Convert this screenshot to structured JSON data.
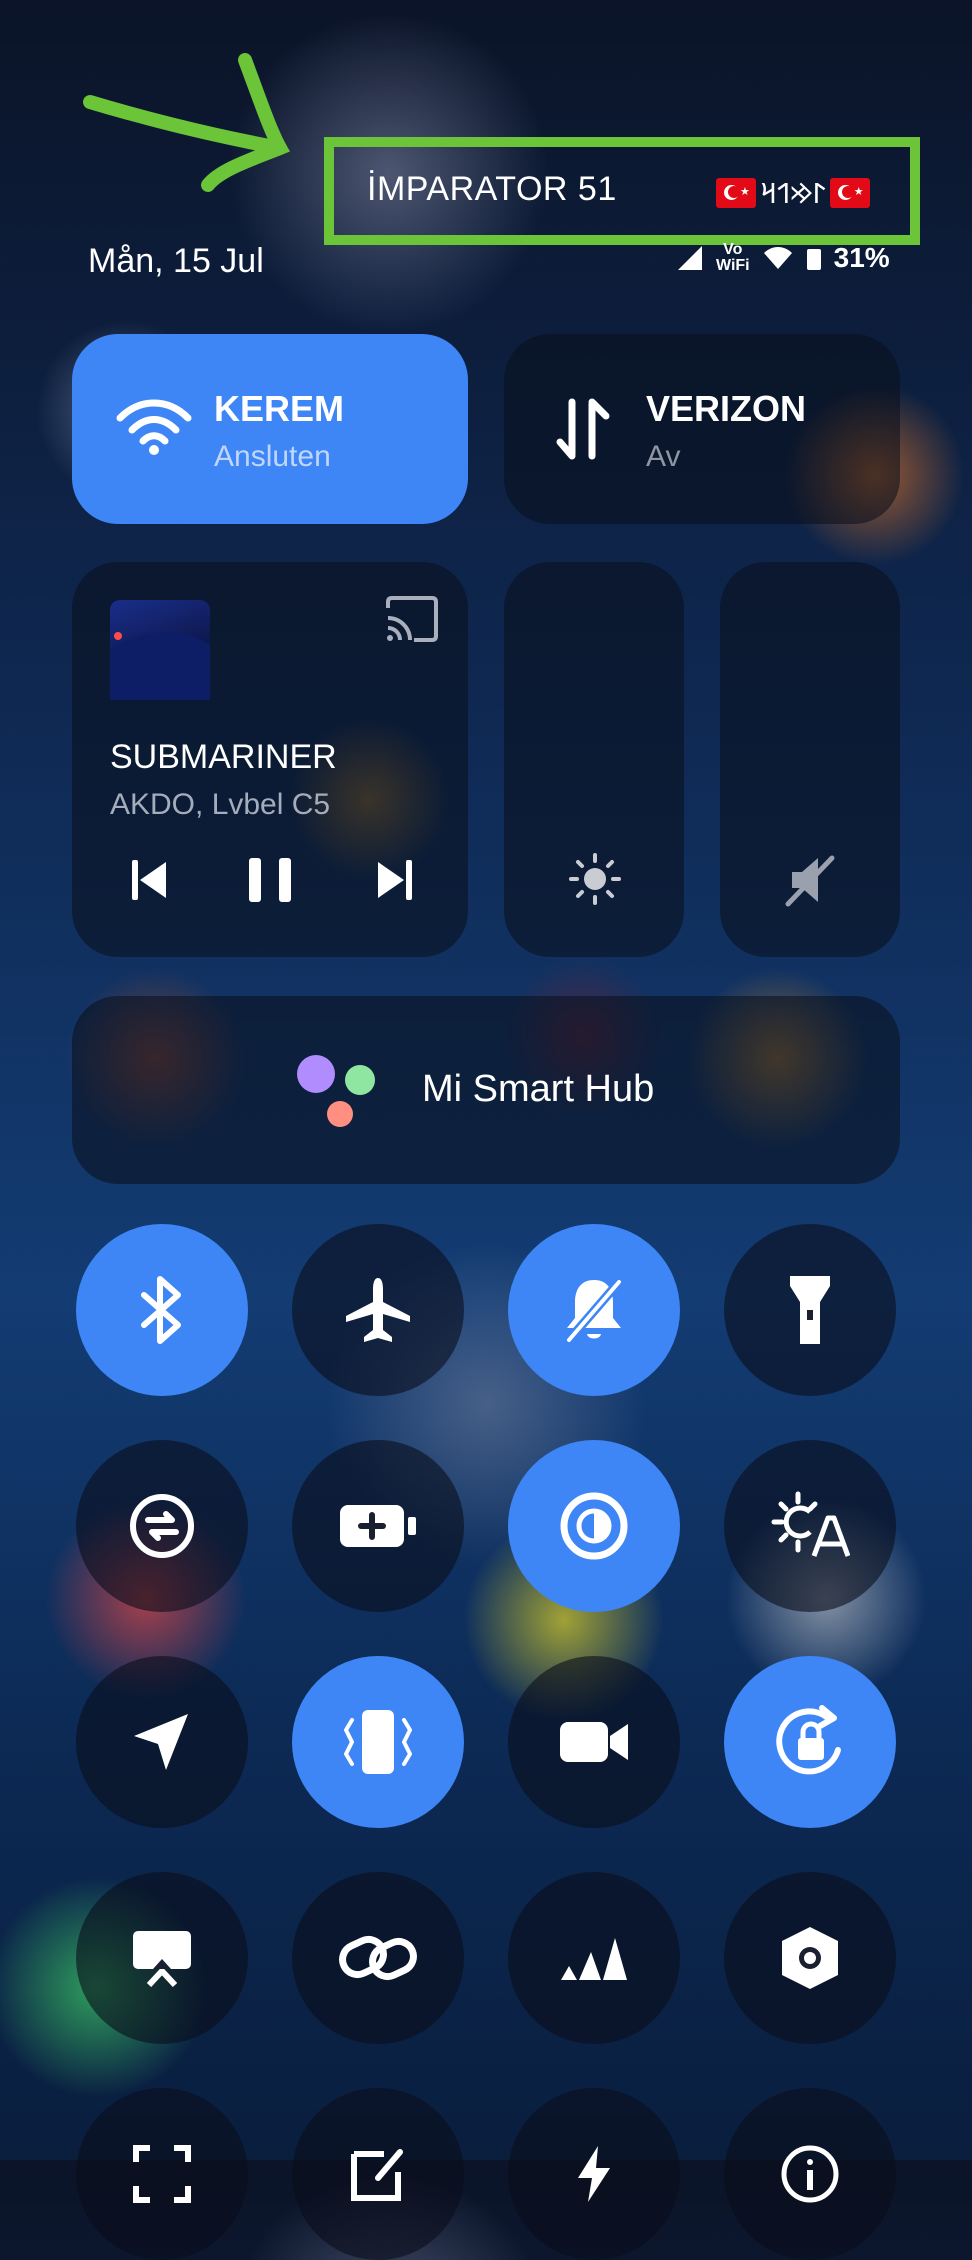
{
  "annotation": {
    "box_color": "#6cc439"
  },
  "header": {
    "carrier_label": "İMPARATOR 51",
    "turkic_text": "𐰃𐰢𐰯𐰺",
    "date": "Mån, 15 Jul",
    "network_label_top": "Vo",
    "network_label_bottom": "WiFi",
    "battery": "31%"
  },
  "wifi_tile": {
    "name": "KEREM",
    "status": "Ansluten",
    "active": true
  },
  "mobile_tile": {
    "name": "VERIZON",
    "status": "Av",
    "active": false
  },
  "media": {
    "title": "SUBMARINER",
    "artist": "AKDO, Lvbel C5"
  },
  "smart_hub": {
    "label": "Mi Smart Hub"
  },
  "toggles": [
    {
      "icon": "bluetooth-icon",
      "active": true
    },
    {
      "icon": "airplane-icon",
      "active": false
    },
    {
      "icon": "mute-bell-icon",
      "active": true
    },
    {
      "icon": "flashlight-icon",
      "active": false
    },
    {
      "icon": "transfer-icon",
      "active": false
    },
    {
      "icon": "battery-saver-icon",
      "active": false
    },
    {
      "icon": "reading-mode-icon",
      "active": true
    },
    {
      "icon": "auto-brightness-icon",
      "active": false
    },
    {
      "icon": "location-icon",
      "active": false
    },
    {
      "icon": "vibrate-icon",
      "active": true
    },
    {
      "icon": "video-camera-icon",
      "active": false
    },
    {
      "icon": "rotation-lock-icon",
      "active": true
    },
    {
      "icon": "cast-screen-icon",
      "active": false
    },
    {
      "icon": "link-icon",
      "active": false
    },
    {
      "icon": "adidas-icon",
      "active": false
    },
    {
      "icon": "settings-hex-icon",
      "active": false
    }
  ],
  "colors": {
    "accent": "#3e86f5",
    "tile_dark": "rgba(10,14,26,0.55)"
  }
}
